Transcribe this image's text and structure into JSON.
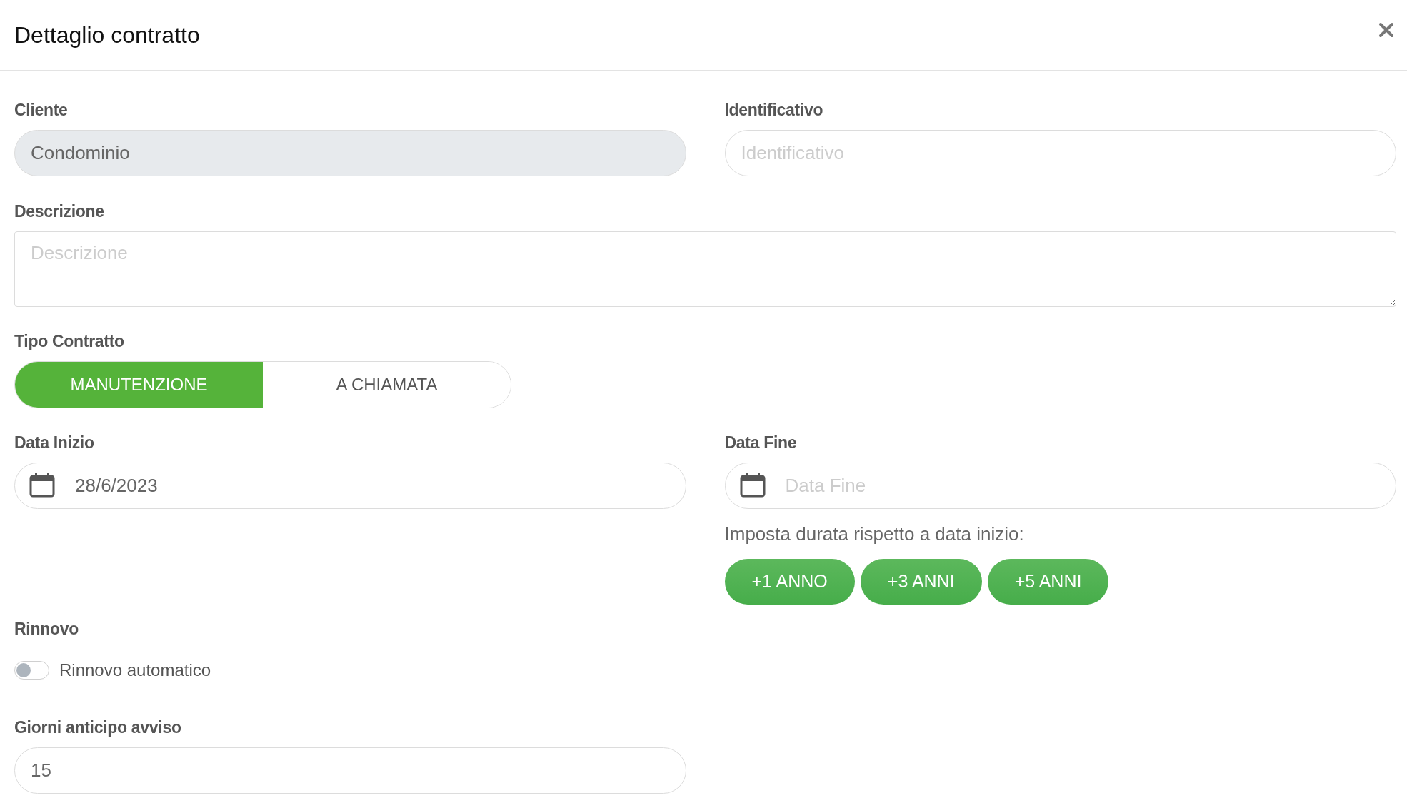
{
  "dialog": {
    "title": "Dettaglio contratto"
  },
  "cliente": {
    "label": "Cliente",
    "value": "Condominio",
    "disabled": true
  },
  "identificativo": {
    "label": "Identificativo",
    "placeholder": "Identificativo",
    "disabled": false
  },
  "descrizione": {
    "label": "Descrizione",
    "placeholder": "Descrizione"
  },
  "tipo_contratto": {
    "label": "Tipo Contratto",
    "options": [
      {
        "label": "MANUTENZIONE",
        "selected": true
      },
      {
        "label": "A CHIAMATA",
        "selected": false
      }
    ]
  },
  "data_inizio": {
    "label": "Data Inizio",
    "value": "28/6/2023"
  },
  "data_fine": {
    "label": "Data Fine",
    "placeholder": "Data Fine"
  },
  "durata": {
    "hint": "Imposta durata rispetto a data inizio:",
    "buttons": [
      "+1 ANNO",
      "+3 ANNI",
      "+5 ANNI"
    ]
  },
  "rinnovo": {
    "label": "Rinnovo",
    "toggle": {
      "label": "Rinnovo automatico",
      "on": false
    }
  },
  "giorni_anticipo_avviso": {
    "label": "Giorni anticipo avviso",
    "value": "15"
  }
}
